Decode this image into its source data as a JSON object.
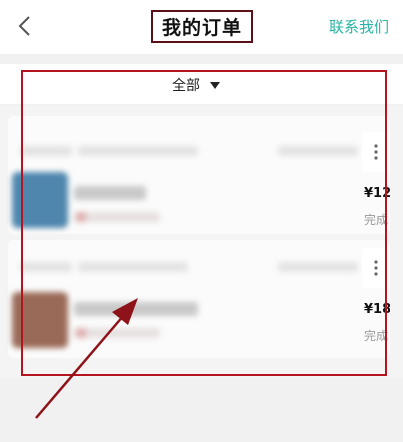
{
  "header": {
    "title": "我的订单",
    "contact_label": "联系我们",
    "back_icon": "chevron-left-icon"
  },
  "filter": {
    "selected": "全部",
    "icon": "caret-down-icon"
  },
  "orders": [
    {
      "price": "¥12",
      "status": "完成"
    },
    {
      "price": "¥18",
      "status": "完成"
    }
  ],
  "colors": {
    "accent": "#2ab3a4",
    "annotation_red": "#b4141e",
    "title_box": "#5b0f16"
  }
}
